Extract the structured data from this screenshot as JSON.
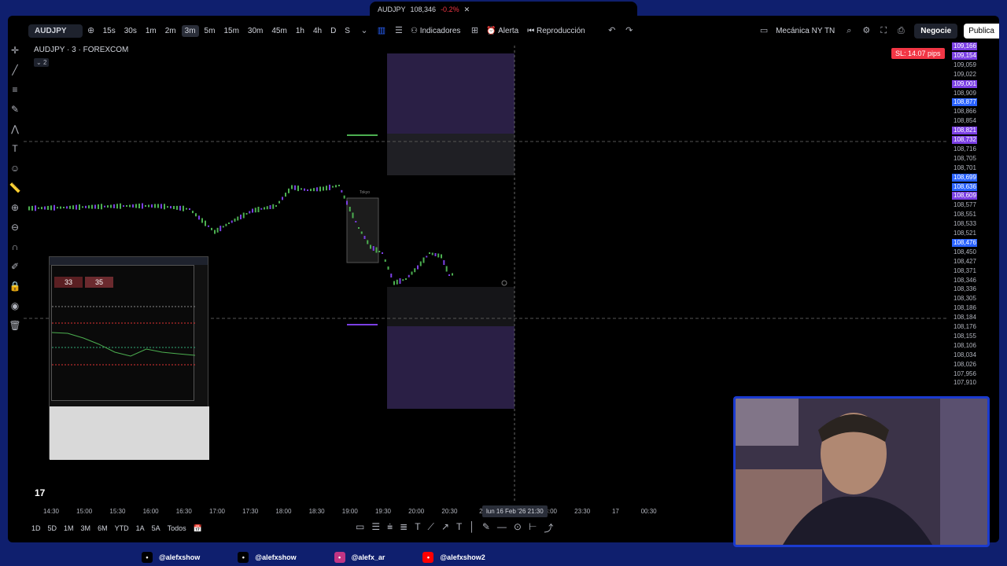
{
  "browser_tab": {
    "symbol": "AUDJPY",
    "price": "108,346",
    "change": "-0.2%"
  },
  "toolbar": {
    "symbol": "AUDJPY",
    "timeframes": [
      "15s",
      "30s",
      "1m",
      "2m",
      "3m",
      "5m",
      "15m",
      "30m",
      "45m",
      "1h",
      "4h",
      "D",
      "S"
    ],
    "active_timeframe": "3m",
    "indicators_label": "Indicadores",
    "alert_label": "Alerta",
    "replay_label": "Reproducción",
    "layout_name": "Mecánica NY TN",
    "trade_label": "Negocie",
    "publish_label": "Publica"
  },
  "chart": {
    "title": "AUDJPY · 3 · FOREXCOM",
    "sub_badge": "2",
    "sl_badge": "SL: 14.07 pips",
    "session_label": "Tokyo",
    "price_labels": [
      {
        "v": "109,166",
        "c": "#7b3fe4"
      },
      {
        "v": "109,154",
        "c": "#7b3fe4"
      },
      {
        "v": "109,059",
        "c": ""
      },
      {
        "v": "109,022",
        "c": ""
      },
      {
        "v": "109,001",
        "c": "#7b3fe4"
      },
      {
        "v": "108,909",
        "c": ""
      },
      {
        "v": "108,877",
        "c": "#2962ff"
      },
      {
        "v": "108,866",
        "c": ""
      },
      {
        "v": "108,854",
        "c": ""
      },
      {
        "v": "108,821",
        "c": "#7b3fe4"
      },
      {
        "v": "108,732",
        "c": "#7b3fe4"
      },
      {
        "v": "108,716",
        "c": ""
      },
      {
        "v": "108,705",
        "c": ""
      },
      {
        "v": "108,701",
        "c": ""
      },
      {
        "v": "108,699",
        "c": "#2962ff"
      },
      {
        "v": "108,636",
        "c": "#2962ff"
      },
      {
        "v": "108,609",
        "c": "#7b3fe4"
      },
      {
        "v": "108,577",
        "c": ""
      },
      {
        "v": "108,551",
        "c": ""
      },
      {
        "v": "108,533",
        "c": ""
      },
      {
        "v": "108,521",
        "c": ""
      },
      {
        "v": "108,476",
        "c": "#2962ff"
      },
      {
        "v": "108,450",
        "c": ""
      },
      {
        "v": "108,427",
        "c": ""
      },
      {
        "v": "108,371",
        "c": ""
      },
      {
        "v": "108,346",
        "c": ""
      },
      {
        "v": "108,336",
        "c": ""
      },
      {
        "v": "108,305",
        "c": ""
      },
      {
        "v": "108,186",
        "c": ""
      },
      {
        "v": "108,184",
        "c": ""
      },
      {
        "v": "108,176",
        "c": ""
      },
      {
        "v": "108,155",
        "c": ""
      },
      {
        "v": "108,106",
        "c": ""
      },
      {
        "v": "108,034",
        "c": ""
      },
      {
        "v": "108,026",
        "c": ""
      },
      {
        "v": "107,956",
        "c": ""
      },
      {
        "v": "107,910",
        "c": ""
      }
    ],
    "time_labels": [
      "14:30",
      "15:00",
      "15:30",
      "16:00",
      "16:30",
      "17:00",
      "17:30",
      "18:00",
      "18:30",
      "19:00",
      "19:30",
      "20:00",
      "20:30",
      "21",
      "22:30",
      "23:00",
      "23:30",
      "17",
      "00:30"
    ],
    "crosshair_time": "lun 16 Feb '26   21:30"
  },
  "bottom": {
    "ranges": [
      "1D",
      "5D",
      "1M",
      "3M",
      "6M",
      "YTD",
      "1A",
      "5A",
      "Todos"
    ]
  },
  "mini_chart": {
    "price_left": "33",
    "price_right": "35"
  },
  "socials": [
    {
      "name": "@alefxshow",
      "icon": "tiktok-icon",
      "color": "#000000"
    },
    {
      "name": "@alefxshow",
      "icon": "x-icon",
      "color": "#000000"
    },
    {
      "name": "@alefx_ar",
      "icon": "instagram-icon",
      "color": "#c13584"
    },
    {
      "name": "@alefxshow2",
      "icon": "youtube-icon",
      "color": "#ff0000"
    }
  ],
  "colors": {
    "bull": "#4caf50",
    "bear": "#7b3fe4",
    "accent": "#2962ff",
    "sl": "#f23645"
  }
}
